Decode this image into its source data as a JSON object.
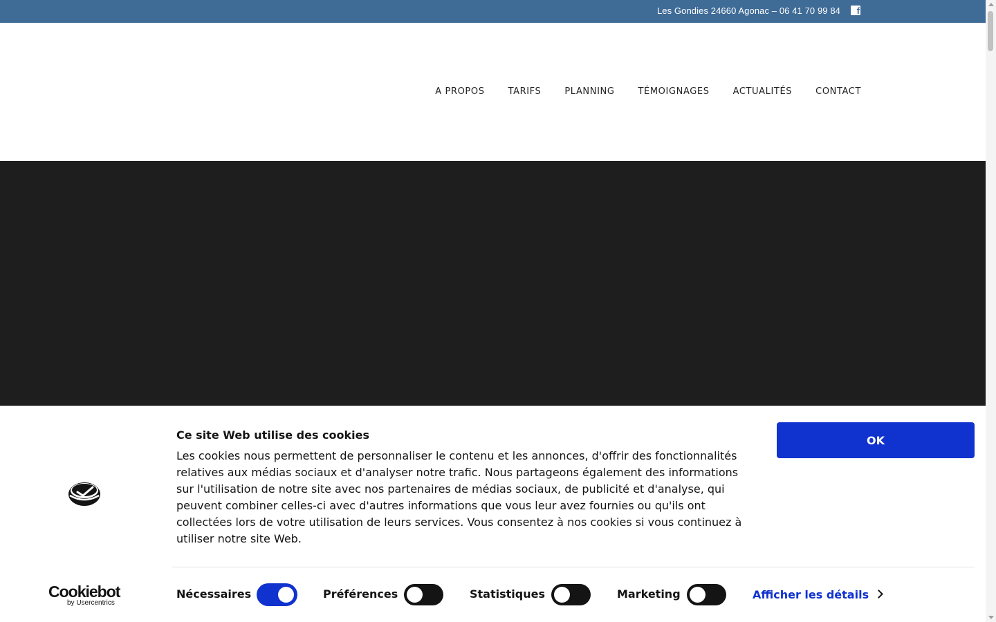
{
  "topbar": {
    "contact_text": "Les Gondies 24660 Agonac – 06 41 70 99 84",
    "facebook_icon": "facebook-icon"
  },
  "nav": {
    "items": [
      {
        "label": "A PROPOS"
      },
      {
        "label": "TARIFS"
      },
      {
        "label": "PLANNING"
      },
      {
        "label": "TÉMOIGNAGES"
      },
      {
        "label": "ACTUALITÉS"
      },
      {
        "label": "CONTACT"
      }
    ]
  },
  "cookie_banner": {
    "title": "Ce site Web utilise des cookies",
    "body": "Les cookies nous permettent de personnaliser le contenu et les annonces, d'offrir des fonctionnalités relatives aux médias sociaux et d'analyser notre trafic. Nous partageons également des informations sur l'utilisation de notre site avec nos partenaires de médias sociaux, de publicité et d'analyse, qui peuvent combiner celles-ci avec d'autres informations que vous leur avez fournies ou qu'ils ont collectées lors de votre utilisation de leurs services. Vous consentez à nos cookies si vous continuez à utiliser notre site Web.",
    "ok_label": "OK",
    "brand_name": "Cookiebot",
    "brand_sub": "by Usercentrics",
    "categories": [
      {
        "label": "Nécessaires",
        "checked": true
      },
      {
        "label": "Préférences",
        "checked": false
      },
      {
        "label": "Statistiques",
        "checked": false
      },
      {
        "label": "Marketing",
        "checked": false
      }
    ],
    "details_label": "Afficher les détails"
  },
  "colors": {
    "topbar": "#3f6b97",
    "accent": "#1032cf",
    "hero": "#1e1e1e"
  }
}
